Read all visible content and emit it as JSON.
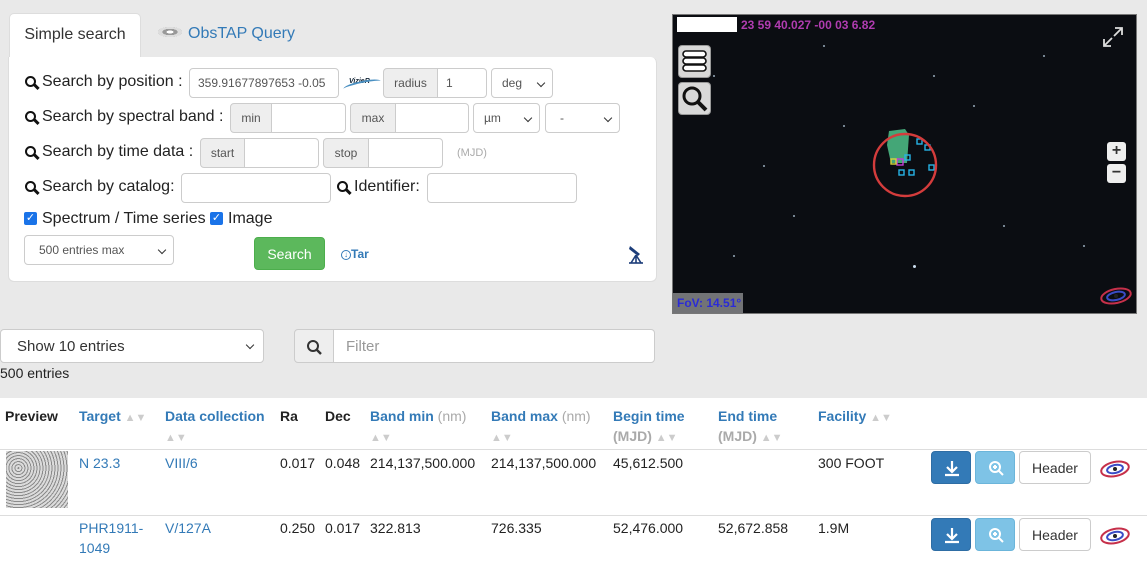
{
  "tabs": [
    {
      "label": "Simple search",
      "active": true
    },
    {
      "label": "ObsTAP Query",
      "active": false
    }
  ],
  "search": {
    "position_label": "Search by position :",
    "position_value": "359.91677897653 -0.05",
    "vizier_logo": "VizieR",
    "radius_label": "radius",
    "radius_value": "1",
    "radius_unit": "deg",
    "spectral_label": "Search by spectral band :",
    "min_label": "min",
    "max_label": "max",
    "spectral_unit": "µm",
    "spectral_option": "-",
    "time_label": "Search by time data :",
    "start_label": "start",
    "stop_label": "stop",
    "time_hint": "(MJD)",
    "catalog_label": "Search by catalog:",
    "identifier_label": "Identifier:",
    "spectrum_label": "Spectrum / Time series",
    "image_label": "Image",
    "max_entries": "500 entries max",
    "search_button": "Search",
    "tar_label": "Tar"
  },
  "sky": {
    "coordinates": "23 59 40.027 -00 03 6.82",
    "fov": "FoV: 14.51°",
    "zoom_in": "+",
    "zoom_out": "−"
  },
  "table_controls": {
    "show_entries": "Show 10 entries",
    "filter_placeholder": "Filter",
    "entries_count": "500 entries"
  },
  "table": {
    "headers": {
      "preview": "Preview",
      "target": "Target",
      "collection": "Data collection",
      "ra": "Ra",
      "dec": "Dec",
      "band_min": "Band min",
      "band_min_unit": "(nm)",
      "band_max": "Band max",
      "band_max_unit": "(nm)",
      "begin": "Begin time",
      "begin_unit": "(MJD)",
      "end": "End time",
      "end_unit": "(MJD)",
      "facility": "Facility"
    },
    "rows": [
      {
        "target": "N 23.3",
        "collection": "VIII/6",
        "ra": "0.017",
        "dec": "0.048",
        "band_min": "214,137,500.000",
        "band_max": "214,137,500.000",
        "begin": "45,612.500",
        "end": "",
        "facility": "300 FOOT",
        "header_button": "Header"
      },
      {
        "target_line1": "PHR1911-",
        "target_line2": "1049",
        "collection": "V/127A",
        "ra": "0.250",
        "dec": "0.017",
        "band_min": "322.813",
        "band_max": "726.335",
        "begin": "52,476.000",
        "end": "52,672.858",
        "facility": "1.9M",
        "header_button": "Header"
      }
    ]
  },
  "colors": {
    "link": "#337ab7",
    "search_button": "#5cb85c",
    "download_button": "#337ab7",
    "zoom_button": "#7ec3e6",
    "coordinates": "#b03cb0",
    "fov_text": "#2b2bd6",
    "sky_circle": "#d43c3c"
  }
}
